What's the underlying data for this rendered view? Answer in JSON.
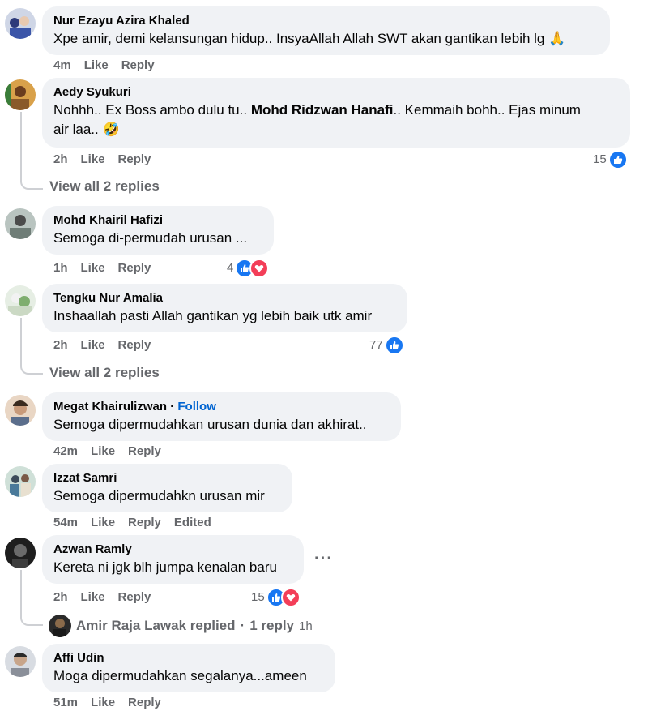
{
  "comments": [
    {
      "name": "Nur Ezayu Azira Khaled",
      "text": "Xpe amir, demi kelansungan hidup.. InsyaAllah Allah SWT akan gantikan lebih lg 🙏",
      "time": "4m",
      "like": "Like",
      "reply": "Reply"
    },
    {
      "name": "Aedy Syukuri",
      "text_a": "Nohhh.. Ex Boss ambo dulu tu.. ",
      "text_mention": "Mohd Ridzwan Hanafi",
      "text_b": ".. Kemmaih bohh.. Ejas minum",
      "text_c": "air laa.. 🤣",
      "time": "2h",
      "like": "Like",
      "reply": "Reply",
      "reactions": "15",
      "view_replies": "View all 2 replies"
    },
    {
      "name": "Mohd Khairil Hafizi",
      "text": "Semoga di-permudah urusan ...",
      "time": "1h",
      "like": "Like",
      "reply": "Reply",
      "reactions": "4"
    },
    {
      "name": "Tengku Nur Amalia",
      "text": "Inshaallah pasti Allah gantikan yg lebih baik utk amir",
      "time": "2h",
      "like": "Like",
      "reply": "Reply",
      "reactions": "77",
      "view_replies": "View all 2 replies"
    },
    {
      "name": "Megat Khairulizwan",
      "follow": "Follow",
      "separator": "·",
      "text": "Semoga dipermudahkan urusan dunia dan akhirat..",
      "time": "42m",
      "like": "Like",
      "reply": "Reply"
    },
    {
      "name": "Izzat Samri",
      "text": "Semoga dipermudahkn urusan mir",
      "time": "54m",
      "like": "Like",
      "reply": "Reply",
      "edited": "Edited"
    },
    {
      "name": "Azwan Ramly",
      "text": "Kereta ni jgk blh jumpa kenalan baru",
      "time": "2h",
      "like": "Like",
      "reply": "Reply",
      "reactions": "15",
      "more": "···",
      "reply_summary": {
        "author": "Amir Raja Lawak replied",
        "sep": "·",
        "count": "1 reply",
        "time": "1h"
      }
    },
    {
      "name": "Affi Udin",
      "text": "Moga dipermudahkan segalanya...ameen",
      "time": "51m",
      "like": "Like",
      "reply": "Reply"
    }
  ],
  "colors": {
    "like": "#1877f2",
    "love": "#f33e58",
    "bubble": "#f0f2f5",
    "meta": "#65676b",
    "follow": "#0064d1"
  }
}
